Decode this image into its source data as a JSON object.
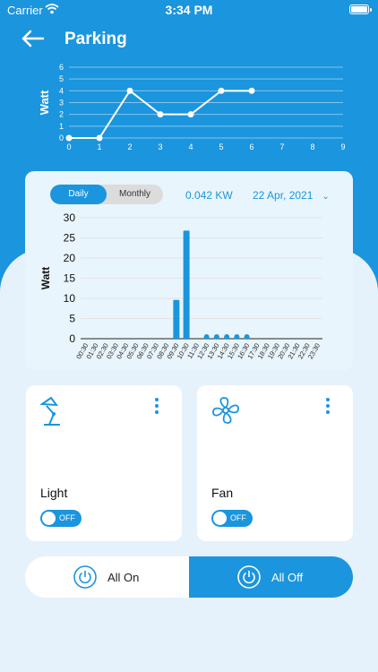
{
  "status": {
    "carrier": "Carrier",
    "time": "3:34 PM"
  },
  "header": {
    "title": "Parking"
  },
  "power_chart": {
    "ylabel": "Watt",
    "x_ticks": [
      "0",
      "1",
      "2",
      "3",
      "4",
      "5",
      "6",
      "7",
      "8",
      "9"
    ],
    "y_ticks": [
      "0",
      "1",
      "2",
      "3",
      "4",
      "5",
      "6"
    ]
  },
  "energy": {
    "tabs": [
      "Daily",
      "Monthly"
    ],
    "active_tab": "Daily",
    "kw_value": "0.042 KW",
    "date": "22 Apr, 2021"
  },
  "devices": [
    {
      "name": "Light",
      "icon": "desk-lamp-icon",
      "toggle": "OFF"
    },
    {
      "name": "Fan",
      "icon": "fan-icon",
      "toggle": "OFF"
    }
  ],
  "controls": {
    "all_on": "All On",
    "all_off": "All Off"
  },
  "colors": {
    "primary": "#1b95dd",
    "background": "#e6f2fb"
  },
  "chart_data": [
    {
      "type": "line",
      "title": "",
      "xlabel": "",
      "ylabel": "Watt",
      "x": [
        0,
        1,
        2,
        3,
        4,
        5,
        6
      ],
      "values": [
        0,
        0,
        4,
        2,
        2,
        4,
        4
      ],
      "xlim": [
        0,
        9
      ],
      "ylim": [
        0,
        6
      ],
      "grid": true
    },
    {
      "type": "bar",
      "title": "",
      "xlabel": "",
      "ylabel": "Watt",
      "categories": [
        "00:30",
        "01:30",
        "02:30",
        "03:30",
        "04:30",
        "05:30",
        "06:30",
        "07:30",
        "08:30",
        "09:30",
        "10:30",
        "11:30",
        "12:30",
        "13:30",
        "14:30",
        "15:30",
        "16:30",
        "17:30",
        "18:30",
        "19:30",
        "20:30",
        "21:30",
        "22:30",
        "23:30"
      ],
      "values": [
        0,
        0,
        0,
        0,
        0,
        0,
        0,
        0,
        0,
        9.6,
        26.8,
        0,
        0.5,
        0.5,
        0.5,
        0.5,
        0.5,
        0,
        0,
        0,
        0,
        0,
        0,
        0
      ],
      "y_ticks": [
        "0",
        "5",
        "10",
        "15",
        "20",
        "25",
        "30"
      ],
      "ylim": [
        0,
        30
      ],
      "grid": true
    }
  ]
}
